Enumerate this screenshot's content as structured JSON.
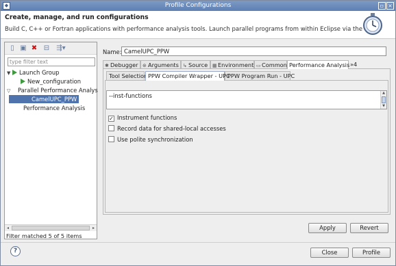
{
  "window": {
    "title": "Profile Configurations"
  },
  "header": {
    "title": "Create, manage, and run configurations",
    "description": "Build C, C++ or Fortran applications with performance analysis tools.  Launch parallel programs from within Eclipse via the PTP.",
    "icon": "stopwatch-icon"
  },
  "left": {
    "filter_placeholder": "type filter text",
    "tree": [
      {
        "label": "Launch Group",
        "expanded": true,
        "level": 0
      },
      {
        "label": "New_configuration",
        "level": 1
      },
      {
        "label": "Parallel Performance Analys",
        "expanded": true,
        "level": 0
      },
      {
        "label": "CamelUPC_PPW",
        "level": 1,
        "selected": true
      },
      {
        "label": "Performance Analysis",
        "level": 0
      }
    ],
    "status": "Filter matched 5 of 5 items"
  },
  "right": {
    "name_label": "Name:",
    "name_value": "CamelUPC_PPW",
    "tabs": [
      "Debugger",
      "Arguments",
      "Source",
      "Environment",
      "Common",
      "Performance Analysis",
      "»4"
    ],
    "active_tab": "Performance Analysis",
    "subtabs": [
      "Tool Selection",
      "PPW Compiler Wrapper - UPC",
      "PPW Program Run - UPC"
    ],
    "active_subtab": "PPW Compiler Wrapper - UPC",
    "textarea_value": "--inst-functions",
    "checkboxes": [
      {
        "label": "Instrument functions",
        "checked": true
      },
      {
        "label": "Record data for shared-local accesses",
        "checked": false
      },
      {
        "label": "Use polite synchronization",
        "checked": false
      }
    ],
    "apply": "Apply",
    "revert": "Revert"
  },
  "footer": {
    "close": "Close",
    "profile": "Profile"
  }
}
